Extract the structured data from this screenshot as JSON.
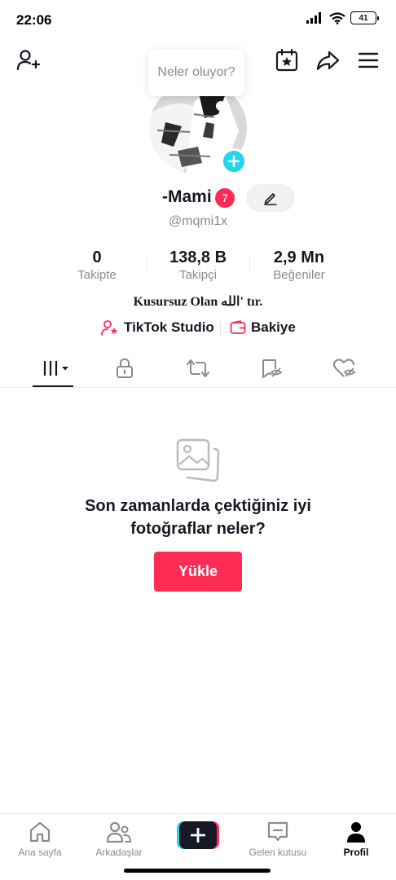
{
  "status_bar": {
    "time": "22:06",
    "battery": "41"
  },
  "tooltip": {
    "text": "Neler oluyor?"
  },
  "profile": {
    "display_name": "-Mami",
    "notification_count": "7",
    "username": "@mqmi1x",
    "bio": "Kusursuz Olan الله' tır."
  },
  "stats": [
    {
      "value": "0",
      "label": "Takipte"
    },
    {
      "value": "138,8 B",
      "label": "Takipçi"
    },
    {
      "value": "2,9 Mn",
      "label": "Beğeniler"
    }
  ],
  "links": {
    "studio": "TikTok Studio",
    "balance": "Bakiye"
  },
  "empty_state": {
    "title": "Son zamanlarda çektiğiniz iyi fotoğraflar neler?",
    "button": "Yükle"
  },
  "bottom_nav": {
    "home": "Ana sayfa",
    "friends": "Arkadaşlar",
    "inbox": "Gelen kutusu",
    "profile": "Profil"
  },
  "colors": {
    "accent": "#fe2c55",
    "cyan": "#20d5ec",
    "text": "#161823",
    "muted": "#8a8b91"
  }
}
